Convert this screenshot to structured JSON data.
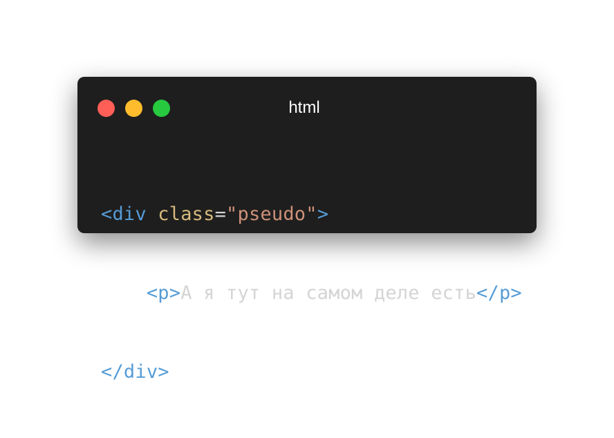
{
  "window": {
    "title": "html",
    "colors": {
      "background": "#1e1e1e",
      "close": "#ff5f56",
      "minimize": "#ffbd2e",
      "maximize": "#27c93f"
    }
  },
  "code": {
    "line1": {
      "open": "<div",
      "attr_name": "class",
      "equals": "=",
      "attr_value": "\"pseudo\"",
      "close": ">"
    },
    "line2": {
      "indent": "    ",
      "open_tag": "<p>",
      "text": "А я тут на самом деле есть",
      "close_tag": "</p>"
    },
    "line3": {
      "close_tag": "</div>"
    }
  }
}
